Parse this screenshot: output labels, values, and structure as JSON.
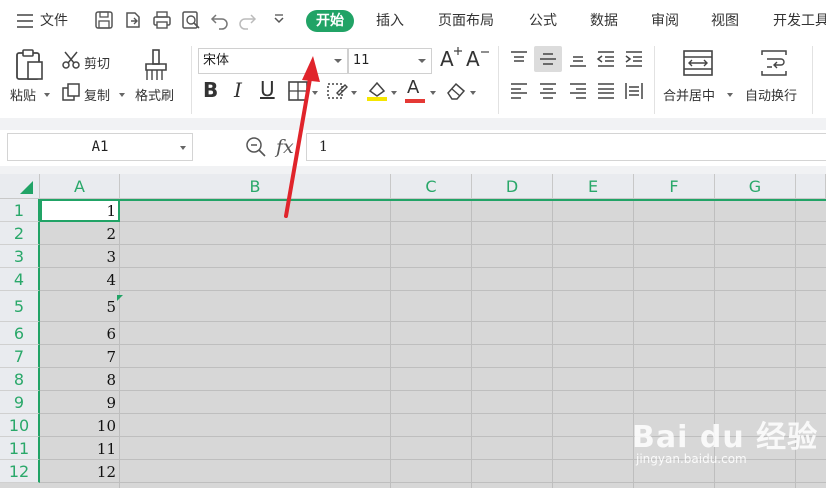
{
  "menubar": {
    "file_label": "文件",
    "tabs": [
      {
        "label": "开始",
        "active": true
      },
      {
        "label": "插入"
      },
      {
        "label": "页面布局"
      },
      {
        "label": "公式"
      },
      {
        "label": "数据"
      },
      {
        "label": "审阅"
      },
      {
        "label": "视图"
      },
      {
        "label": "开发工具"
      }
    ],
    "quick_access": [
      "save-icon",
      "export-icon",
      "print-icon",
      "print-preview-icon",
      "undo-icon",
      "redo-icon",
      "customize-icon"
    ]
  },
  "ribbon": {
    "clipboard": {
      "paste_label": "粘贴",
      "cut_label": "剪切",
      "copy_label": "复制",
      "format_painter_label": "格式刷"
    },
    "font": {
      "font_name": "宋体",
      "font_size": "11",
      "icons": [
        "bold-icon",
        "italic-icon",
        "underline-icon",
        "border-icon",
        "fill-color-icon",
        "highlight-icon",
        "font-color-icon",
        "clear-format-icon",
        "increase-font-icon",
        "decrease-font-icon"
      ],
      "bold_glyph": "B",
      "italic_glyph": "I",
      "underline_glyph": "U",
      "font_color_glyph": "A",
      "increase_glyph": "A",
      "decrease_glyph": "A"
    },
    "alignment": {
      "merge_label": "合并居中",
      "wrap_label": "自动换行"
    }
  },
  "formula_bar": {
    "name_box": "A1",
    "fx_label": "fx",
    "formula_value": "1"
  },
  "sheet": {
    "columns": [
      "A",
      "B",
      "C",
      "D",
      "E",
      "F",
      "G"
    ],
    "rows": [
      "1",
      "2",
      "3",
      "4",
      "5",
      "6",
      "7",
      "8",
      "9",
      "10",
      "11",
      "12"
    ],
    "column_a_values": [
      "1",
      "2",
      "3",
      "4",
      "5",
      "6",
      "7",
      "8",
      "9",
      "10",
      "11",
      "12"
    ]
  },
  "colors": {
    "accent": "#21a366",
    "annotation_arrow": "#e0242b"
  },
  "watermark": {
    "brand": "Bai du 经验",
    "url": "jingyan.baidu.com"
  }
}
